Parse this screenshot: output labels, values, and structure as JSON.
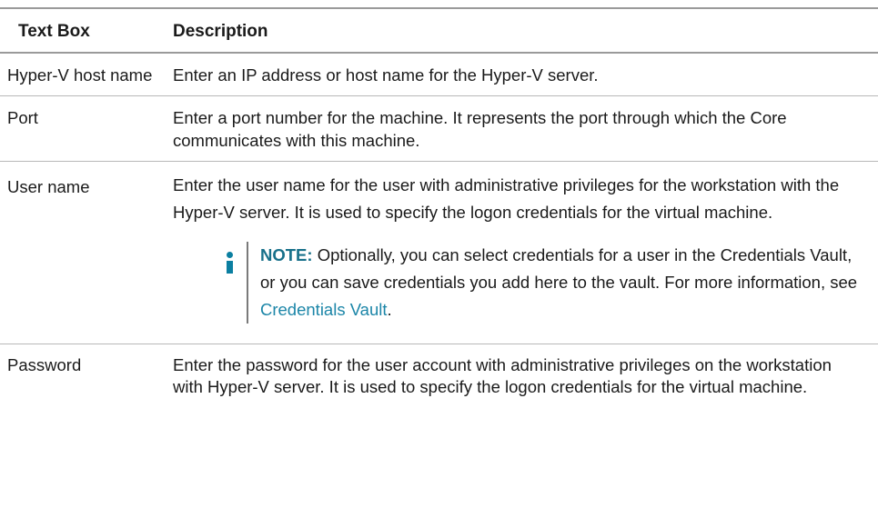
{
  "table": {
    "headers": [
      "Text Box",
      "Description"
    ],
    "rows": [
      {
        "field": "Hyper-V host name",
        "description": "Enter an IP address or host name for the Hyper-V server."
      },
      {
        "field": "Port",
        "description": "Enter a port number for the machine. It represents the port through which the Core communicates with this machine."
      },
      {
        "field": "User name",
        "description": "Enter the user name for the user with administrative privileges for the workstation with the Hyper-V server. It is used to specify the logon credentials for the virtual machine.",
        "note": {
          "label": "NOTE:",
          "text": " Optionally, you can select credentials for a user in the Credentials Vault, or you can save credentials you add here to the vault. For more information, see ",
          "link": "Credentials Vault",
          "end": "."
        }
      },
      {
        "field": "Password",
        "description": "Enter the password for the user account with administrative privileges on the workstation with Hyper-V server. It is used to specify the logon credentials for the virtual machine."
      }
    ]
  },
  "colors": {
    "note_icon": "#0b7fa1",
    "note_label": "#17708a",
    "link": "#1c86a8"
  }
}
